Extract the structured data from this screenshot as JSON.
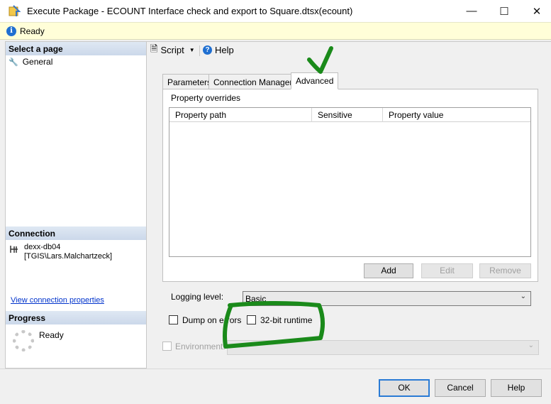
{
  "window": {
    "title": "Execute Package - ECOUNT Interface check and export to Square.dtsx(ecount)"
  },
  "status": {
    "text": "Ready"
  },
  "left": {
    "select_page_header": "Select a page",
    "pages": [
      {
        "label": "General",
        "icon": "wrench-icon"
      }
    ],
    "connection_header": "Connection",
    "server": "dexx-db04",
    "user": "[TGIS\\Lars.Malchartzeck]",
    "view_connection_link": "View connection properties",
    "progress_header": "Progress",
    "progress_status": "Ready"
  },
  "toolbar": {
    "script_label": "Script",
    "help_label": "Help"
  },
  "tabs": [
    {
      "label": "Parameters",
      "active": false
    },
    {
      "label": "Connection Managers",
      "active": false
    },
    {
      "label": "Advanced",
      "active": true
    }
  ],
  "advanced": {
    "property_overrides_label": "Property overrides",
    "columns": [
      "Property path",
      "Sensitive",
      "Property value"
    ],
    "add_label": "Add",
    "edit_label": "Edit",
    "remove_label": "Remove",
    "logging_level_label": "Logging level:",
    "logging_level_value": "Basic",
    "dump_on_errors_label": "Dump on errors",
    "dump_on_errors_checked": false,
    "runtime_32bit_label": "32-bit runtime",
    "runtime_32bit_checked": false,
    "environment_label": "Environment:"
  },
  "buttons": {
    "ok": "OK",
    "cancel": "Cancel",
    "help": "Help"
  },
  "annotation_color": "#1a8a1a"
}
